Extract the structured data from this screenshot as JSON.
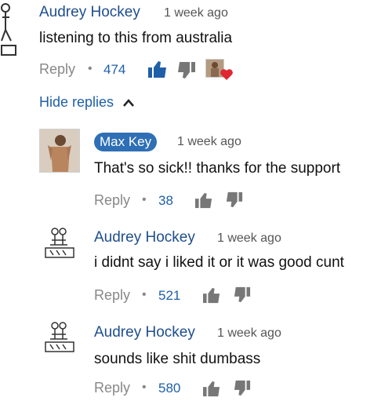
{
  "comment": {
    "author": "Audrey Hockey",
    "time": "1 week ago",
    "text": "listening to this from australia",
    "reply_label": "Reply",
    "likes": "474",
    "hide_replies": "Hide replies"
  },
  "replies": [
    {
      "author": "Max Key",
      "time": "1 week ago",
      "text": "That's so sick!! thanks for the support",
      "reply_label": "Reply",
      "likes": "38"
    },
    {
      "author": "Audrey Hockey",
      "time": "1 week ago",
      "text": "i didnt say i liked it or it was good cunt",
      "reply_label": "Reply",
      "likes": "521"
    },
    {
      "author": "Audrey Hockey",
      "time": "1 week ago",
      "text": "sounds like shit dumbass",
      "reply_label": "Reply",
      "likes": "580"
    }
  ],
  "colors": {
    "author": "#1f4e8c",
    "link": "#1f5fa8",
    "badge": "#2f6fb5",
    "heart": "#e0262f",
    "muted": "#888888"
  },
  "icons": [
    "thumbs-up-icon",
    "thumbs-down-icon",
    "heart-icon",
    "chevron-up-icon"
  ]
}
